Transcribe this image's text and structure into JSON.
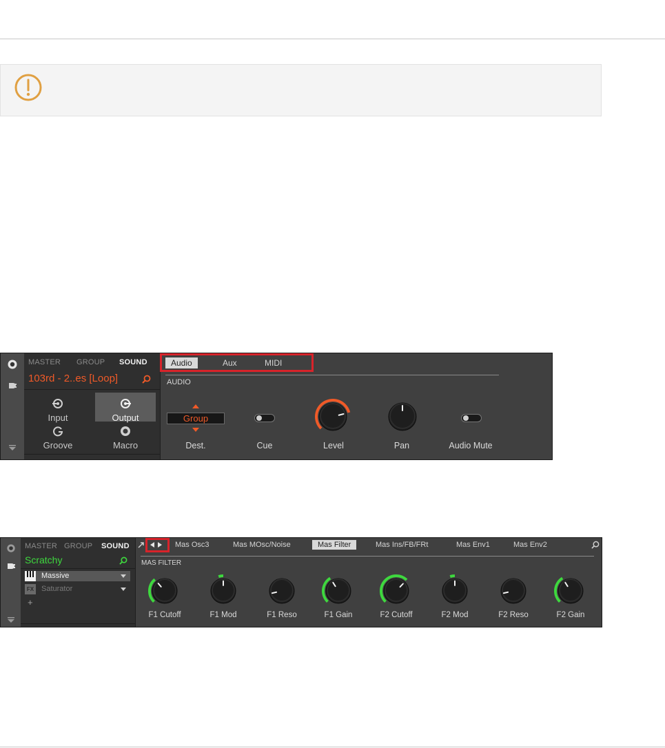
{
  "notice": {
    "icon": "exclamation-circle-icon",
    "icon_color": "#e0a042"
  },
  "panel1": {
    "header_tabs": [
      "MASTER",
      "GROUP",
      "SOUND"
    ],
    "active_header_tab": "SOUND",
    "sound_name": "103rd - 2..es [Loop]",
    "sound_name_color": "#f05a28",
    "pages": [
      {
        "label": "Input",
        "icon": "input-icon",
        "selected": false
      },
      {
        "label": "Output",
        "icon": "output-icon",
        "selected": true
      },
      {
        "label": "Groove",
        "icon": "groove-icon",
        "selected": false
      },
      {
        "label": "Macro",
        "icon": "macro-icon",
        "selected": false
      }
    ],
    "tabs": [
      "Audio",
      "Aux",
      "MIDI"
    ],
    "active_tab": "Audio",
    "section": "AUDIO",
    "controls": {
      "dest": {
        "label": "Dest.",
        "value": "Group"
      },
      "cue": {
        "label": "Cue",
        "state": "off"
      },
      "level": {
        "label": "Level",
        "fraction": 0.78,
        "arc_color": "#f05a28"
      },
      "pan": {
        "label": "Pan",
        "fraction": 0.5
      },
      "audio_mute": {
        "label": "Audio Mute",
        "state": "off"
      }
    },
    "highlight_color": "#d8232a"
  },
  "panel2": {
    "header_tabs": [
      "MASTER",
      "GROUP",
      "SOUND"
    ],
    "active_header_tab": "SOUND",
    "sound_name": "Scratchy",
    "sound_name_color": "#3ed83e",
    "slots": [
      {
        "name": "Massive",
        "icon": "piano-keys-icon",
        "active": true
      },
      {
        "name": "Saturator",
        "icon": "fx-icon",
        "active": false
      }
    ],
    "add_label": "+",
    "pages": [
      "Mas Osc3",
      "Mas MOsc/Noise",
      "Mas Filter",
      "Mas Ins/FB/FRt",
      "Mas Env1",
      "Mas Env2"
    ],
    "active_page": "Mas Filter",
    "section": "MAS FILTER",
    "knobs": [
      {
        "label": "F1 Cutoff",
        "fraction": 0.35
      },
      {
        "label": "F1 Mod",
        "fraction": 0.5
      },
      {
        "label": "F1 Reso",
        "fraction": 0.12
      },
      {
        "label": "F1 Gain",
        "fraction": 0.38
      },
      {
        "label": "F2 Cutoff",
        "fraction": 0.66
      },
      {
        "label": "F2 Mod",
        "fraction": 0.5
      },
      {
        "label": "F2 Reso",
        "fraction": 0.12
      },
      {
        "label": "F2 Gain",
        "fraction": 0.38
      }
    ],
    "arc_color": "#3ed83e"
  }
}
